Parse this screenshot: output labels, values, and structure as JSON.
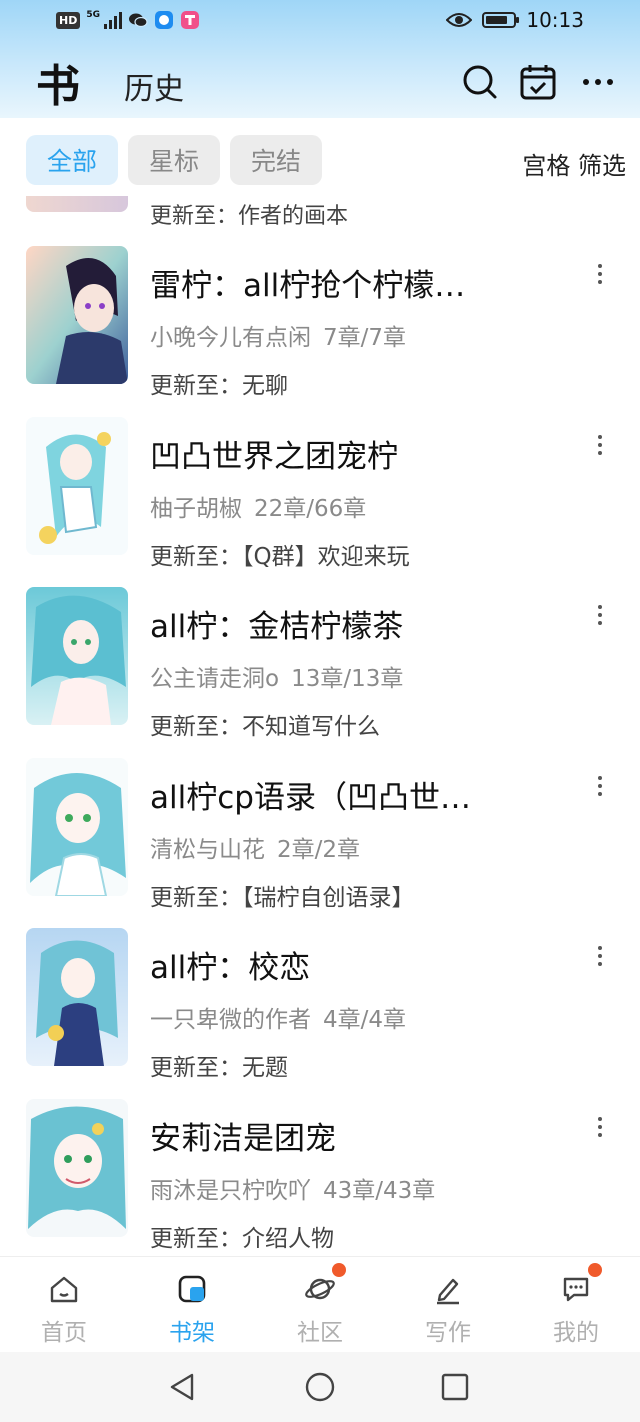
{
  "status_bar": {
    "hd": "HD",
    "network": "5G",
    "time": "10:13"
  },
  "header": {
    "tab_book": "书",
    "tab_history": "历史",
    "icons": [
      "search-icon",
      "calendar-check-icon",
      "more-horizontal-icon"
    ]
  },
  "filters": {
    "chips": [
      {
        "label": "全部",
        "active": true
      },
      {
        "label": "星标",
        "active": false
      },
      {
        "label": "完结",
        "active": false
      }
    ],
    "grid_filter": "宫格 筛选"
  },
  "partial_item": {
    "update": "更新至：作者的画本"
  },
  "books": [
    {
      "title": "雷柠：all柠抢个柠檬…",
      "author": "小晚今儿有点闲",
      "chapters": "7章/7章",
      "update": "更新至：无聊"
    },
    {
      "title": "凹凸世界之团宠柠",
      "author": "柚子胡椒",
      "chapters": "22章/66章",
      "update": "更新至：【Q群】欢迎来玩"
    },
    {
      "title": "all柠：金桔柠檬茶",
      "author": "公主请走洞o",
      "chapters": "13章/13章",
      "update": "更新至：不知道写什么"
    },
    {
      "title": "all柠cp语录（凹凸世…",
      "author": "清松与山花",
      "chapters": "2章/2章",
      "update": "更新至：【瑞柠自创语录】"
    },
    {
      "title": "all柠：校恋",
      "author": "一只卑微的作者",
      "chapters": "4章/4章",
      "update": "更新至：无题"
    },
    {
      "title": "安莉洁是团宠",
      "author": "雨沐是只柠吹吖",
      "chapters": "43章/43章",
      "update": "更新至：介绍人物"
    }
  ],
  "bottom_nav": [
    {
      "label": "首页",
      "icon": "home-icon",
      "active": false,
      "badge": false
    },
    {
      "label": "书架",
      "icon": "bookshelf-icon",
      "active": true,
      "badge": false
    },
    {
      "label": "社区",
      "icon": "planet-icon",
      "active": false,
      "badge": true
    },
    {
      "label": "写作",
      "icon": "pen-icon",
      "active": false,
      "badge": false
    },
    {
      "label": "我的",
      "icon": "message-icon",
      "active": false,
      "badge": true
    }
  ],
  "colors": {
    "accent": "#2aa3ee",
    "badge": "#f05a2b",
    "header_gradient_top": "#9fd6f7"
  }
}
